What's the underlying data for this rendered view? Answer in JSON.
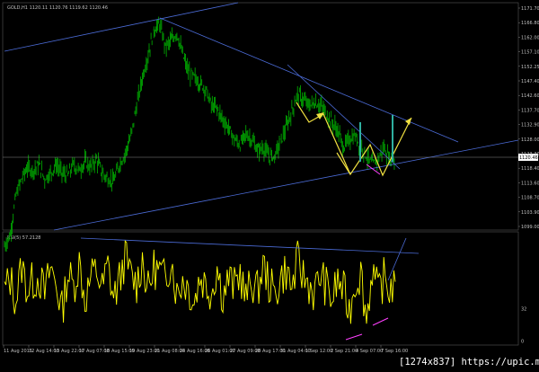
{
  "colors": {
    "background": "#000000",
    "candle": "#00a000",
    "rsi": "#ffff00",
    "trendline": "#4b6bd6",
    "pattern": "#f0e040",
    "marker": "#ff40ff",
    "vbar": "#2fb0a0",
    "axis": "#c0c0c0"
  },
  "main_panel": {
    "header": "GOLD,H1  1120.11 1120.76 1119.62 1120.46",
    "current_price_label": "1120.46"
  },
  "rsi_panel": {
    "header": "RSI(5) 57.2128"
  },
  "chart_data": [
    {
      "type": "line",
      "series": [
        {
          "values": [
            1089,
            1093,
            1107,
            1113,
            1117,
            1116,
            1118,
            1113,
            1115,
            1118,
            1115,
            1114,
            1118,
            1116,
            1119,
            1117,
            1120,
            1115,
            1113,
            1112,
            1118,
            1122,
            1128,
            1139,
            1149,
            1157,
            1166,
            1168,
            1160,
            1162,
            1165,
            1157,
            1151,
            1149,
            1147,
            1145,
            1139,
            1138,
            1134,
            1131,
            1127,
            1125,
            1129,
            1127,
            1123,
            1124,
            1121,
            1121,
            1126,
            1131,
            1137,
            1143,
            1141,
            1139,
            1140,
            1139,
            1136,
            1133,
            1130,
            1124,
            1127,
            1128,
            1125,
            1121,
            1118,
            1120,
            1124,
            1120,
            1120
          ]
        }
      ],
      "y_ticks": [
        "1171.70",
        "1166.80",
        "1162.00",
        "1157.10",
        "1152.25",
        "1147.40",
        "1142.60",
        "1137.70",
        "1132.90",
        "1128.00",
        "1123.30",
        "1118.40",
        "1113.60",
        "1108.70",
        "1103.90",
        "1099.00"
      ],
      "x_ticks": [
        "11 Aug 2015",
        "12 Aug 14:00",
        "13 Aug 22:00",
        "17 Aug 07:00",
        "18 Aug 15:00",
        "19 Aug 23:00",
        "21 Aug 08:00",
        "24 Aug 16:00",
        "26 Aug 01:00",
        "27 Aug 09:00",
        "28 Aug 17:00",
        "31 Aug 04:00",
        "1 Sep 12:00",
        "2 Sep 21:00",
        "4 Sep 07:00",
        "7 Sep 16:00"
      ],
      "ylim": [
        1096.0,
        1174.0
      ]
    },
    {
      "type": "line",
      "series": [
        {
          "values": [
            48,
            60,
            40,
            72,
            50,
            58,
            62,
            45,
            70,
            55,
            30,
            65,
            52,
            75,
            40,
            60,
            68,
            50,
            72,
            42,
            58,
            80,
            62,
            55,
            78,
            48,
            70,
            66,
            58,
            80,
            45,
            60,
            52,
            38,
            62,
            55,
            48,
            70,
            44,
            60,
            52,
            66,
            40,
            58,
            48,
            72,
            56,
            44,
            60,
            68,
            50,
            76,
            62,
            55,
            46,
            64,
            52,
            40,
            58,
            48,
            30,
            56,
            66,
            22,
            70,
            45,
            60,
            50,
            57
          ]
        }
      ],
      "y_ticks": [
        "32",
        "0"
      ],
      "ylim": [
        0,
        100
      ]
    }
  ]
}
